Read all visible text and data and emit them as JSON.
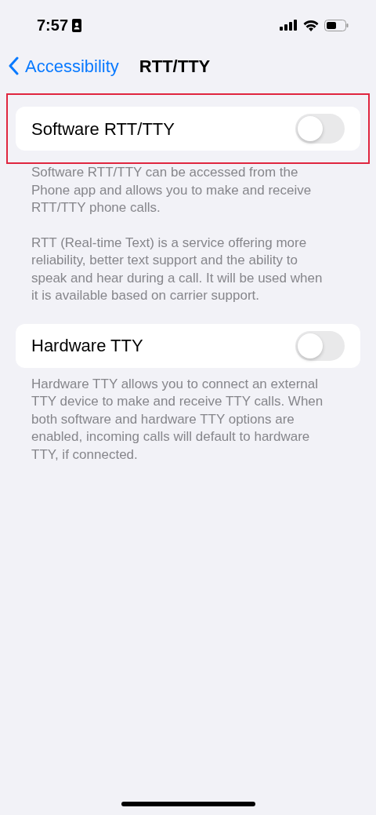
{
  "status_bar": {
    "time": "7:57"
  },
  "nav": {
    "back": "Accessibility",
    "title": "RTT/TTY"
  },
  "sections": [
    {
      "label": "Software RTT/TTY",
      "on": false,
      "highlighted": true,
      "footer": [
        "Software RTT/TTY can be accessed from the Phone app and allows you to make and receive RTT/TTY phone calls.",
        "RTT (Real-time Text) is a service offering more reliability, better text support and the ability to speak and hear during a call. It will be used when it is available based on carrier support."
      ]
    },
    {
      "label": "Hardware TTY",
      "on": false,
      "highlighted": false,
      "footer": [
        "Hardware TTY allows you to connect an external TTY device to make and receive TTY calls. When both software and hardware TTY options are enabled, incoming calls will default to hardware TTY, if connected."
      ]
    }
  ]
}
